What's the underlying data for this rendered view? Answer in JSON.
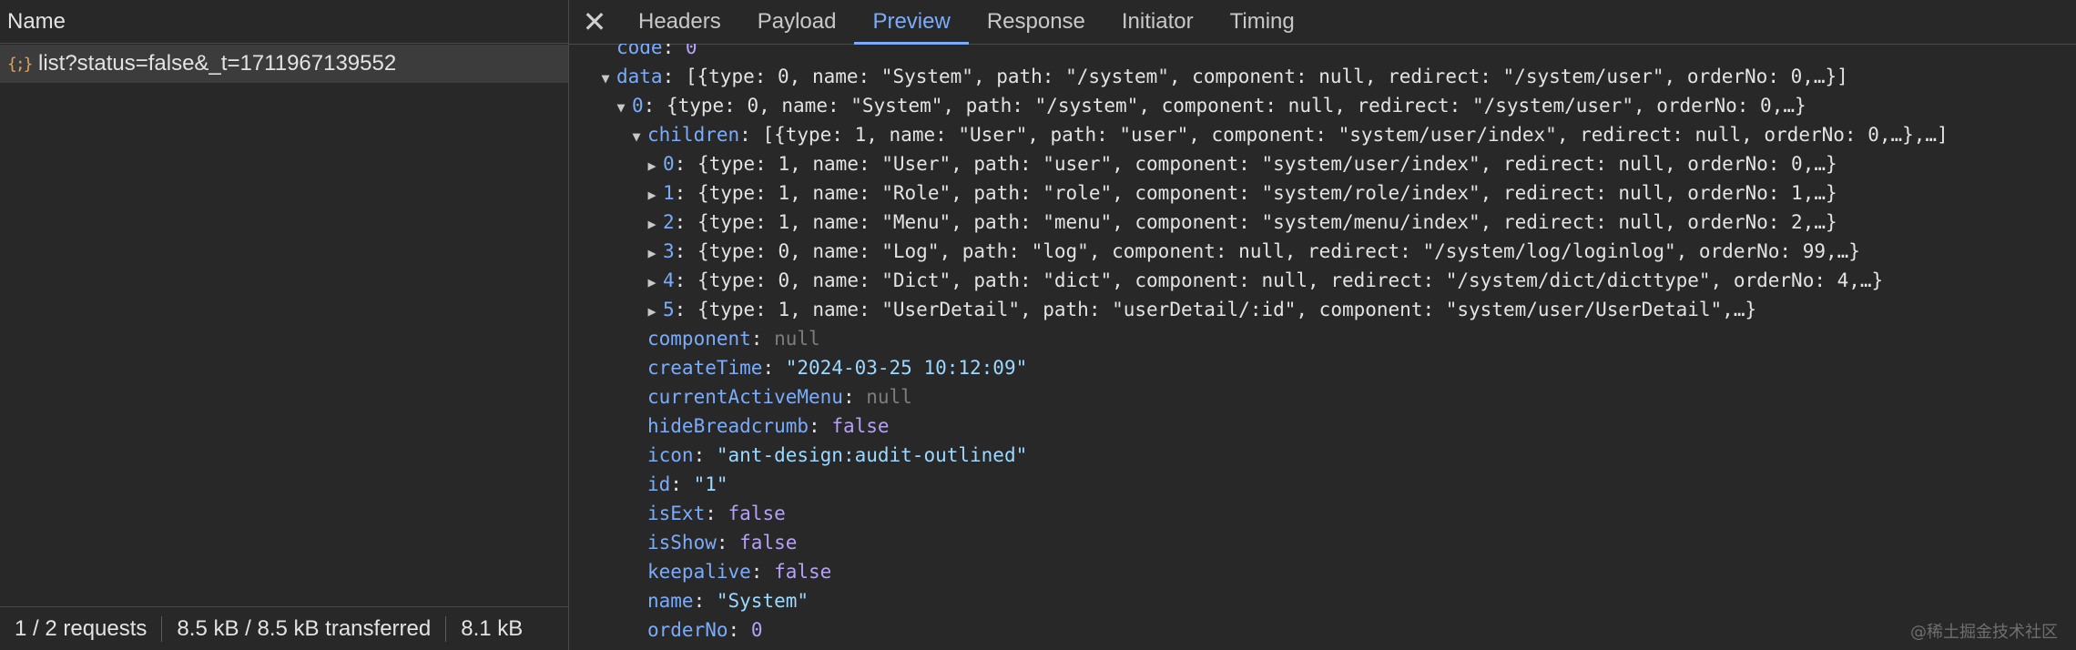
{
  "left_panel": {
    "header": "Name",
    "request": {
      "icon": "{;}",
      "name": "list?status=false&_t=1711967139552"
    },
    "status": [
      "1 / 2 requests",
      "8.5 kB / 8.5 kB transferred",
      "8.1 kB"
    ]
  },
  "tabs": {
    "close": "✕",
    "items": [
      "Headers",
      "Payload",
      "Preview",
      "Response",
      "Initiator",
      "Timing"
    ],
    "active": "Preview"
  },
  "lines": [
    {
      "indent": 0,
      "toggle": "",
      "key": "code",
      "parts": [
        {
          "t": "0",
          "c": "num"
        }
      ]
    },
    {
      "indent": 0,
      "toggle": "▼",
      "key": "data",
      "parts": [
        {
          "t": "[{type: 0, name: \"System\", path: \"/system\", component: null, redirect: \"/system/user\", orderNo: 0,…}]",
          "c": "plain"
        }
      ]
    },
    {
      "indent": 1,
      "toggle": "▼",
      "key": "0",
      "parts": [
        {
          "t": "{type: 0, name: \"System\", path: \"/system\", component: null, redirect: \"/system/user\", orderNo: 0,…}",
          "c": "plain"
        }
      ]
    },
    {
      "indent": 2,
      "toggle": "▼",
      "key": "children",
      "parts": [
        {
          "t": "[{type: 1, name: \"User\", path: \"user\", component: \"system/user/index\", redirect: null, orderNo: 0,…},…]",
          "c": "plain"
        }
      ]
    },
    {
      "indent": 3,
      "toggle": "▶",
      "key": "0",
      "parts": [
        {
          "t": "{type: 1, name: \"User\", path: \"user\", component: \"system/user/index\", redirect: null, orderNo: 0,…}",
          "c": "plain"
        }
      ]
    },
    {
      "indent": 3,
      "toggle": "▶",
      "key": "1",
      "parts": [
        {
          "t": "{type: 1, name: \"Role\", path: \"role\", component: \"system/role/index\", redirect: null, orderNo: 1,…}",
          "c": "plain"
        }
      ]
    },
    {
      "indent": 3,
      "toggle": "▶",
      "key": "2",
      "parts": [
        {
          "t": "{type: 1, name: \"Menu\", path: \"menu\", component: \"system/menu/index\", redirect: null, orderNo: 2,…}",
          "c": "plain"
        }
      ]
    },
    {
      "indent": 3,
      "toggle": "▶",
      "key": "3",
      "parts": [
        {
          "t": "{type: 0, name: \"Log\", path: \"log\", component: null, redirect: \"/system/log/loginlog\", orderNo: 99,…}",
          "c": "plain"
        }
      ]
    },
    {
      "indent": 3,
      "toggle": "▶",
      "key": "4",
      "parts": [
        {
          "t": "{type: 0, name: \"Dict\", path: \"dict\", component: null, redirect: \"/system/dict/dicttype\", orderNo: 4,…}",
          "c": "plain"
        }
      ]
    },
    {
      "indent": 3,
      "toggle": "▶",
      "key": "5",
      "parts": [
        {
          "t": "{type: 1, name: \"UserDetail\", path: \"userDetail/:id\", component: \"system/user/UserDetail\",…}",
          "c": "plain"
        }
      ]
    },
    {
      "indent": 2,
      "toggle": "",
      "key": "component",
      "parts": [
        {
          "t": "null",
          "c": "nul"
        }
      ]
    },
    {
      "indent": 2,
      "toggle": "",
      "key": "createTime",
      "parts": [
        {
          "t": "\"2024-03-25 10:12:09\"",
          "c": "str"
        }
      ]
    },
    {
      "indent": 2,
      "toggle": "",
      "key": "currentActiveMenu",
      "parts": [
        {
          "t": "null",
          "c": "nul"
        }
      ]
    },
    {
      "indent": 2,
      "toggle": "",
      "key": "hideBreadcrumb",
      "parts": [
        {
          "t": "false",
          "c": "kw"
        }
      ]
    },
    {
      "indent": 2,
      "toggle": "",
      "key": "icon",
      "parts": [
        {
          "t": "\"ant-design:audit-outlined\"",
          "c": "str"
        }
      ]
    },
    {
      "indent": 2,
      "toggle": "",
      "key": "id",
      "parts": [
        {
          "t": "\"1\"",
          "c": "str"
        }
      ]
    },
    {
      "indent": 2,
      "toggle": "",
      "key": "isExt",
      "parts": [
        {
          "t": "false",
          "c": "kw"
        }
      ]
    },
    {
      "indent": 2,
      "toggle": "",
      "key": "isShow",
      "parts": [
        {
          "t": "false",
          "c": "kw"
        }
      ]
    },
    {
      "indent": 2,
      "toggle": "",
      "key": "keepalive",
      "parts": [
        {
          "t": "false",
          "c": "kw"
        }
      ]
    },
    {
      "indent": 2,
      "toggle": "",
      "key": "name",
      "parts": [
        {
          "t": "\"System\"",
          "c": "str"
        }
      ]
    },
    {
      "indent": 2,
      "toggle": "",
      "key": "orderNo",
      "parts": [
        {
          "t": "0",
          "c": "num"
        }
      ]
    }
  ],
  "watermark": "@稀土掘金技术社区"
}
